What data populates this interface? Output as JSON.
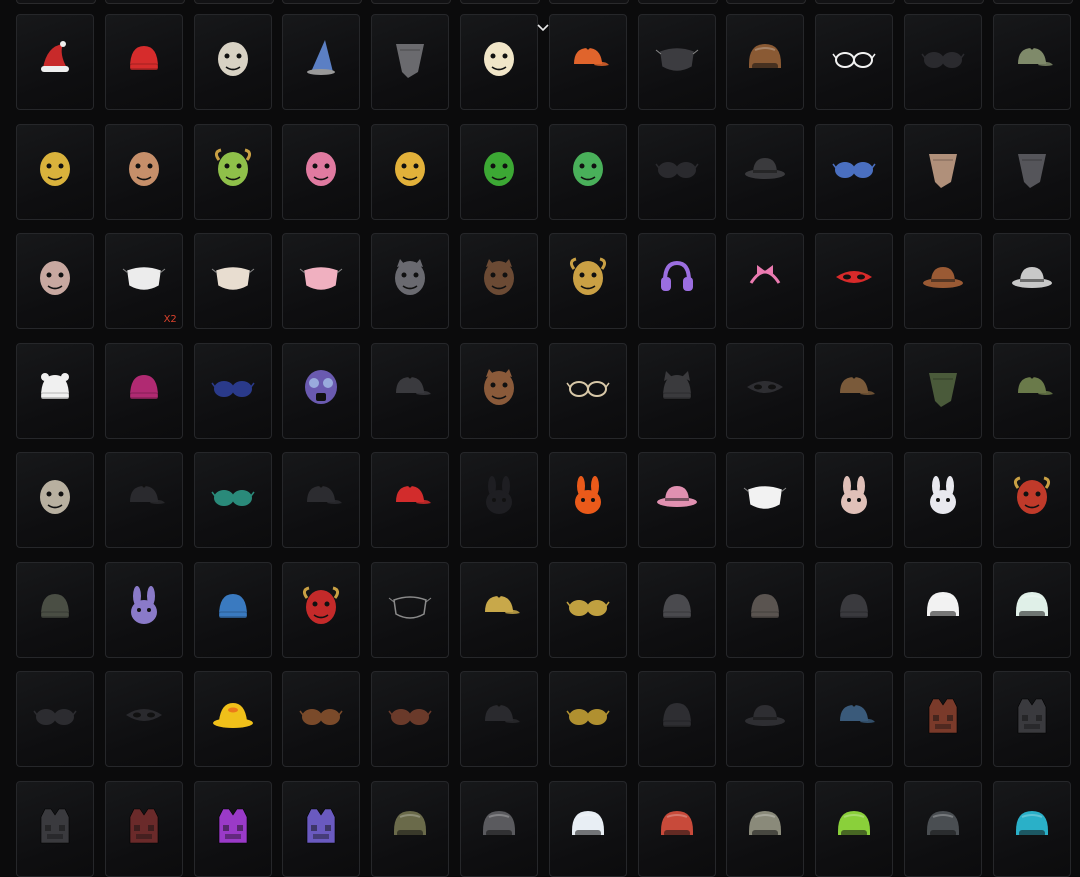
{
  "grid": {
    "items": [
      {
        "icon": "santa-hat-icon",
        "color": "#c82a2a",
        "qty": ""
      },
      {
        "icon": "reindeer-beanie-icon",
        "color": "#d62c2c",
        "qty": ""
      },
      {
        "icon": "fedora-icon",
        "color": "#d8d2c4",
        "qty": ""
      },
      {
        "icon": "wizard-hat-icon",
        "color": "#5b7fc4",
        "qty": ""
      },
      {
        "icon": "bandana-icon",
        "color": "#6a6a6e",
        "qty": ""
      },
      {
        "icon": "chicken-mask-icon",
        "color": "#f1e6c8",
        "qty": ""
      },
      {
        "icon": "cap-icon",
        "color": "#e0642c",
        "qty": ""
      },
      {
        "icon": "face-mask-icon",
        "color": "#3c3c40",
        "qty": ""
      },
      {
        "icon": "diving-helmet-icon",
        "color": "#8a5a34",
        "qty": ""
      },
      {
        "icon": "glasses-icon",
        "color": "#f2f2f2",
        "qty": ""
      },
      {
        "icon": "sunglasses-icon",
        "color": "#2a2a2e",
        "qty": ""
      },
      {
        "icon": "cap-icon",
        "color": "#7f8a6a",
        "qty": ""
      },
      {
        "icon": "dino-mask-icon",
        "color": "#d9b23c",
        "qty": ""
      },
      {
        "icon": "mammoth-mask-icon",
        "color": "#c68f6a",
        "qty": ""
      },
      {
        "icon": "triceratops-mask-icon",
        "color": "#8fc04a",
        "qty": ""
      },
      {
        "icon": "hippo-mask-icon",
        "color": "#e07aa0",
        "qty": ""
      },
      {
        "icon": "pterodactyl-mask-icon",
        "color": "#e2b13a",
        "qty": ""
      },
      {
        "icon": "frog-mask-icon",
        "color": "#3ca834",
        "qty": ""
      },
      {
        "icon": "dino-mask-icon",
        "color": "#49b05a",
        "qty": ""
      },
      {
        "icon": "sunglasses-icon",
        "color": "#2a2a2e",
        "qty": ""
      },
      {
        "icon": "cowboy-hat-icon",
        "color": "#3a3a3d",
        "qty": ""
      },
      {
        "icon": "goggles-icon",
        "color": "#4a6fc0",
        "qty": ""
      },
      {
        "icon": "scarf-icon",
        "color": "#b0907a",
        "qty": ""
      },
      {
        "icon": "bandana-icon",
        "color": "#55555a",
        "qty": ""
      },
      {
        "icon": "hockey-mask-icon",
        "color": "#c8a8a0",
        "qty": ""
      },
      {
        "icon": "face-mask-icon",
        "color": "#ececec",
        "qty": "X2"
      },
      {
        "icon": "face-mask-icon",
        "color": "#e8ddd0",
        "qty": ""
      },
      {
        "icon": "face-mask-icon",
        "color": "#f0b0c0",
        "qty": ""
      },
      {
        "icon": "wolf-mask-icon",
        "color": "#6a6a70",
        "qty": ""
      },
      {
        "icon": "dog-mask-icon",
        "color": "#6b4a34",
        "qty": ""
      },
      {
        "icon": "ram-mask-icon",
        "color": "#caa044",
        "qty": ""
      },
      {
        "icon": "headphones-icon",
        "color": "#9b6ee0",
        "qty": ""
      },
      {
        "icon": "bow-headband-icon",
        "color": "#ea7ab0",
        "qty": ""
      },
      {
        "icon": "eye-mask-icon",
        "color": "#d82a2a",
        "qty": ""
      },
      {
        "icon": "cowboy-hat-icon",
        "color": "#9a5a34",
        "qty": ""
      },
      {
        "icon": "cowboy-hat-icon",
        "color": "#c8c8c8",
        "qty": ""
      },
      {
        "icon": "bear-beanie-icon",
        "color": "#f0f0f0",
        "qty": ""
      },
      {
        "icon": "beanie-icon",
        "color": "#b02a72",
        "qty": ""
      },
      {
        "icon": "sunglasses-icon",
        "color": "#2a3a8a",
        "qty": ""
      },
      {
        "icon": "gas-mask-icon",
        "color": "#6a5ab0",
        "qty": ""
      },
      {
        "icon": "cap-icon",
        "color": "#3a3a3e",
        "qty": ""
      },
      {
        "icon": "chimp-mask-icon",
        "color": "#8a5a3a",
        "qty": ""
      },
      {
        "icon": "glasses-icon",
        "color": "#d8c8a8",
        "qty": ""
      },
      {
        "icon": "cat-beanie-icon",
        "color": "#3a3a3d",
        "qty": ""
      },
      {
        "icon": "eye-mask-icon",
        "color": "#2e2e32",
        "qty": ""
      },
      {
        "icon": "aviator-cap-icon",
        "color": "#7a5a3a",
        "qty": ""
      },
      {
        "icon": "bandana-icon",
        "color": "#4a5a3a",
        "qty": ""
      },
      {
        "icon": "military-cap-icon",
        "color": "#6a7a4a",
        "qty": ""
      },
      {
        "icon": "skull-mask-icon",
        "color": "#b8b0a0",
        "qty": ""
      },
      {
        "icon": "officer-cap-icon",
        "color": "#2a2a2e",
        "qty": ""
      },
      {
        "icon": "goggles-icon",
        "color": "#2a8a7a",
        "qty": ""
      },
      {
        "icon": "cap-icon",
        "color": "#2c2c30",
        "qty": ""
      },
      {
        "icon": "cap-icon",
        "color": "#d22c2c",
        "qty": ""
      },
      {
        "icon": "bunny-mask-icon",
        "color": "#1e1e22",
        "qty": ""
      },
      {
        "icon": "bunny-mask-icon",
        "color": "#ea5a1a",
        "qty": ""
      },
      {
        "icon": "bunny-hat-icon",
        "color": "#e090b0",
        "qty": ""
      },
      {
        "icon": "face-mask-icon",
        "color": "#f2f2f2",
        "qty": ""
      },
      {
        "icon": "bunny-mask-icon",
        "color": "#e0c0b8",
        "qty": ""
      },
      {
        "icon": "bunny-mask-icon",
        "color": "#e8e8ee",
        "qty": ""
      },
      {
        "icon": "demon-mask-icon",
        "color": "#c03a2a",
        "qty": ""
      },
      {
        "icon": "beanie-icon",
        "color": "#4a4e44",
        "qty": ""
      },
      {
        "icon": "bunny-mask-icon",
        "color": "#8a7ac8",
        "qty": ""
      },
      {
        "icon": "durag-icon",
        "color": "#3a7ac0",
        "qty": ""
      },
      {
        "icon": "oni-mask-icon",
        "color": "#c42a2a",
        "qty": ""
      },
      {
        "icon": "muzzle-icon",
        "color": "#8a8a8a",
        "qty": ""
      },
      {
        "icon": "cap-icon",
        "color": "#c8a84a",
        "qty": ""
      },
      {
        "icon": "sunglasses-icon",
        "color": "#c0a040",
        "qty": ""
      },
      {
        "icon": "beanie-icon",
        "color": "#4a4a4e",
        "qty": ""
      },
      {
        "icon": "beanie-icon",
        "color": "#5a5450",
        "qty": ""
      },
      {
        "icon": "beanie-icon",
        "color": "#3a3a3e",
        "qty": ""
      },
      {
        "icon": "helmet-icon",
        "color": "#f2f2f2",
        "qty": ""
      },
      {
        "icon": "helmet-icon",
        "color": "#e0f0e8",
        "qty": ""
      },
      {
        "icon": "goggles-icon",
        "color": "#2c2c30",
        "qty": ""
      },
      {
        "icon": "eye-mask-icon",
        "color": "#2a2a2e",
        "qty": ""
      },
      {
        "icon": "duck-hat-icon",
        "color": "#f0c01a",
        "qty": ""
      },
      {
        "icon": "sunglasses-icon",
        "color": "#7a4a2a",
        "qty": ""
      },
      {
        "icon": "sunglasses-icon",
        "color": "#6a3a2a",
        "qty": ""
      },
      {
        "icon": "cap-icon",
        "color": "#2a2a2e",
        "qty": ""
      },
      {
        "icon": "sunglasses-icon",
        "color": "#b09030",
        "qty": ""
      },
      {
        "icon": "beanie-icon",
        "color": "#2e2e32",
        "qty": ""
      },
      {
        "icon": "bucket-hat-icon",
        "color": "#2e2e32",
        "qty": ""
      },
      {
        "icon": "cap-icon",
        "color": "#3a5a7a",
        "qty": ""
      },
      {
        "icon": "vest-icon",
        "color": "#7a3a2a",
        "qty": ""
      },
      {
        "icon": "vest-icon",
        "color": "#3a3a3e",
        "qty": ""
      },
      {
        "icon": "vest-icon",
        "color": "#3a3a3e",
        "qty": ""
      },
      {
        "icon": "vest-icon",
        "color": "#6a2a2a",
        "qty": ""
      },
      {
        "icon": "vest-icon",
        "color": "#9a3ac8",
        "qty": ""
      },
      {
        "icon": "vest-icon",
        "color": "#6a5ac0",
        "qty": ""
      },
      {
        "icon": "helmet-icon",
        "color": "#6a6a4a",
        "qty": ""
      },
      {
        "icon": "helmet-icon",
        "color": "#5a5a5e",
        "qty": ""
      },
      {
        "icon": "helmet-icon",
        "color": "#e8eef4",
        "qty": ""
      },
      {
        "icon": "helmet-icon",
        "color": "#c84a3a",
        "qty": ""
      },
      {
        "icon": "helmet-icon",
        "color": "#8a8a7a",
        "qty": ""
      },
      {
        "icon": "helmet-icon",
        "color": "#8ad03a",
        "qty": ""
      },
      {
        "icon": "helmet-icon",
        "color": "#4a4e52",
        "qty": ""
      },
      {
        "icon": "helmet-icon",
        "color": "#2ab0c8",
        "qty": ""
      }
    ]
  },
  "scroll_indicator": {
    "icon": "chevron-down-icon",
    "color": "#e8e8e8"
  }
}
